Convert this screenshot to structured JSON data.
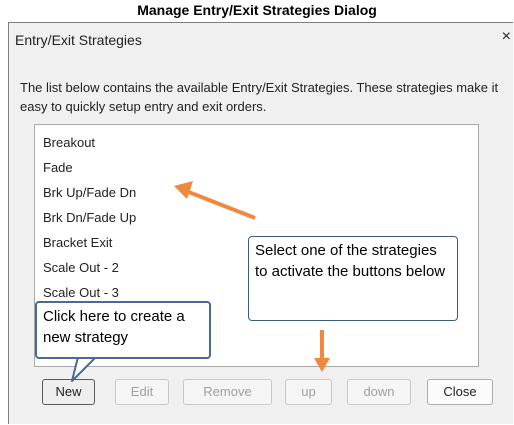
{
  "doc_title": "Manage Entry/Exit Strategies Dialog",
  "dialog": {
    "title": "Entry/Exit Strategies",
    "close_glyph": "×",
    "description": "The list below contains the available Entry/Exit Strategies. These strategies make it easy to quickly setup entry and exit orders."
  },
  "strategies": [
    "Breakout",
    "Fade",
    "Brk Up/Fade Dn",
    "Brk Dn/Fade Up",
    "Bracket Exit",
    "Scale Out - 2",
    "Scale Out - 3"
  ],
  "buttons": {
    "new": "New",
    "edit": "Edit",
    "remove": "Remove",
    "up": "up",
    "down": "down",
    "close": "Close"
  },
  "callouts": {
    "select": "Select one of the strategies to activate the buttons below",
    "new": "Click here to create a new strategy"
  },
  "colors": {
    "arrow": "#f0883e",
    "callout_border": "#4a6b91"
  }
}
